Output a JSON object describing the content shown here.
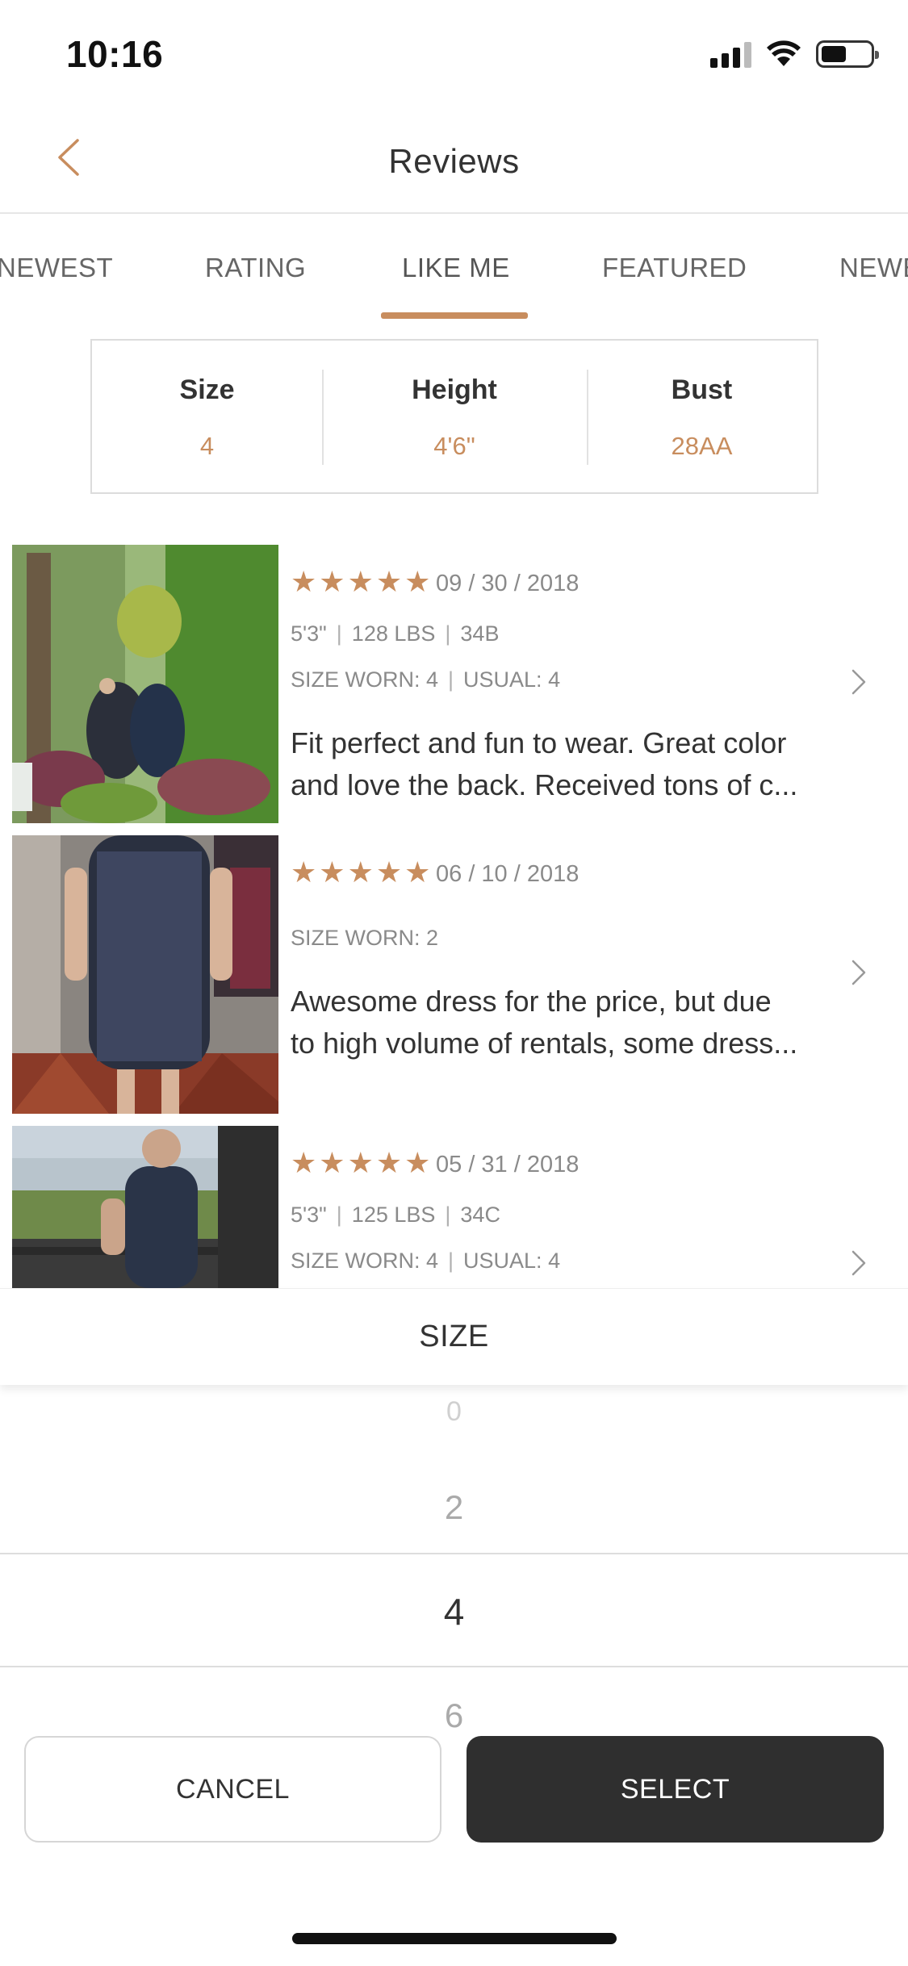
{
  "status_bar": {
    "time": "10:16"
  },
  "header": {
    "title": "Reviews"
  },
  "tabs": [
    {
      "label": "NEWEST"
    },
    {
      "label": "RATING"
    },
    {
      "label": "LIKE ME"
    },
    {
      "label": "FEATURED"
    },
    {
      "label": "NEWEST"
    }
  ],
  "active_tab": "LIKE ME",
  "filters": [
    {
      "label": "Size",
      "value": "4"
    },
    {
      "label": "Height",
      "value": "4'6\""
    },
    {
      "label": "Bust",
      "value": "28AA"
    }
  ],
  "reviews": [
    {
      "rating": 5,
      "date": "09 / 30 / 2018",
      "height": "5'3\"",
      "weight": "128 LBS",
      "bust": "34B",
      "size_worn": "SIZE WORN: 4",
      "usual": "USUAL: 4",
      "text_line1": "Fit perfect and fun to wear. Great color",
      "text_line2": "and love the back. Received tons of c..."
    },
    {
      "rating": 5,
      "date": "06 / 10 / 2018",
      "size_worn": "SIZE WORN: 2",
      "text_line1": "Awesome dress for the price, but due",
      "text_line2": "to high volume of rentals, some dress..."
    },
    {
      "rating": 5,
      "date": "05 / 31 / 2018",
      "height": "5'3\"",
      "weight": "125 LBS",
      "bust": "34C",
      "size_worn": "SIZE WORN: 4",
      "usual": "USUAL: 4"
    }
  ],
  "size_picker": {
    "title": "SIZE",
    "options_visible": [
      "0",
      "2",
      "4",
      "6"
    ],
    "selected": "4"
  },
  "buttons": {
    "cancel": "CANCEL",
    "select": "SELECT"
  },
  "colors": {
    "accent": "#c88d5e",
    "dark_button": "#2f2f2f"
  }
}
